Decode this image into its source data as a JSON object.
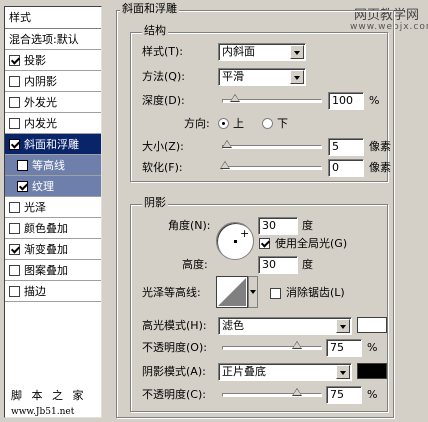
{
  "watermark": {
    "site": "网页教学网",
    "url": "www.webjx.com"
  },
  "sidebar": {
    "header": "样式",
    "items": [
      {
        "label": "混合选项:默认",
        "checkbox": false,
        "checked": false
      },
      {
        "label": "投影",
        "checkbox": true,
        "checked": true
      },
      {
        "label": "内阴影",
        "checkbox": true,
        "checked": false
      },
      {
        "label": "外发光",
        "checkbox": true,
        "checked": false
      },
      {
        "label": "内发光",
        "checkbox": true,
        "checked": false
      },
      {
        "label": "斜面和浮雕",
        "checkbox": true,
        "checked": true,
        "selected": true
      },
      {
        "label": "等高线",
        "checkbox": true,
        "checked": false,
        "sub": true
      },
      {
        "label": "纹理",
        "checkbox": true,
        "checked": true,
        "sub": true
      },
      {
        "label": "光泽",
        "checkbox": true,
        "checked": false
      },
      {
        "label": "颜色叠加",
        "checkbox": true,
        "checked": false
      },
      {
        "label": "渐变叠加",
        "checkbox": true,
        "checked": true
      },
      {
        "label": "图案叠加",
        "checkbox": true,
        "checked": false
      },
      {
        "label": "描边",
        "checkbox": true,
        "checked": false
      }
    ],
    "footer_brand": "脚 本 之 家",
    "footer_url": "www.Jb51.net"
  },
  "panel": {
    "title": "斜面和浮雕",
    "structure": {
      "legend": "结构",
      "style_label": "样式(T):",
      "style_value": "内斜面",
      "technique_label": "方法(Q):",
      "technique_value": "平滑",
      "depth_label": "深度(D):",
      "depth_value": "100",
      "depth_unit": "%",
      "depth_level": 0.1,
      "direction_label": "方向:",
      "direction_up": "上",
      "direction_down": "下",
      "size_label": "大小(Z):",
      "size_value": "5",
      "size_unit": "像素",
      "size_level": 0.02,
      "soften_label": "软化(F):",
      "soften_value": "0",
      "soften_unit": "像素",
      "soften_level": 0.0
    },
    "shading": {
      "legend": "阴影",
      "angle_label": "角度(N):",
      "angle_value": "30",
      "angle_unit": "度",
      "global_light_label": "使用全局光(G)",
      "altitude_label": "高度:",
      "altitude_value": "30",
      "altitude_unit": "度",
      "gloss_label": "光泽等高线:",
      "antialias_label": "消除锯齿(L)",
      "highlight_mode_label": "高光模式(H):",
      "highlight_mode_value": "滤色",
      "highlight_color": "#ffffff",
      "highlight_opacity_label": "不透明度(O):",
      "highlight_opacity_value": "75",
      "highlight_opacity_unit": "%",
      "highlight_opacity_level": 0.75,
      "shadow_mode_label": "阴影模式(A):",
      "shadow_mode_value": "正片叠底",
      "shadow_color": "#000000",
      "shadow_opacity_label": "不透明度(C):",
      "shadow_opacity_value": "75",
      "shadow_opacity_unit": "%",
      "shadow_opacity_level": 0.75
    }
  }
}
